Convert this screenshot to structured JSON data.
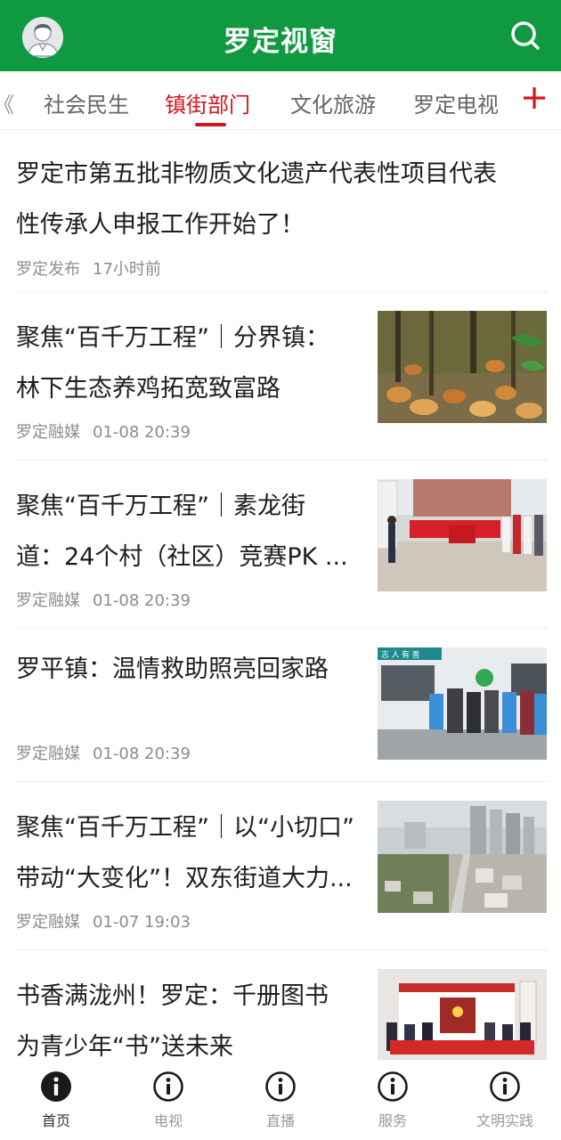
{
  "header": {
    "title": "罗定视窗",
    "brand_color": "#0f9a41"
  },
  "tabs": {
    "partial_left": "《",
    "items": [
      {
        "label": "社会民生",
        "active": false
      },
      {
        "label": "镇街部门",
        "active": true
      },
      {
        "label": "文化旅游",
        "active": false
      },
      {
        "label": "罗定电视",
        "active": false
      }
    ],
    "accent_color": "#d3161e",
    "add_icon": "plus-icon"
  },
  "news": [
    {
      "title_lines": [
        "罗定市第五批非物质文化遗产代表性项目代表",
        "性传承人申报工作开始了！"
      ],
      "source": "罗定发布",
      "time": "17小时前",
      "thumbnail": null
    },
    {
      "title_lines": [
        "聚焦“百千万工程”｜分界镇：",
        "林下生态养鸡拓宽致富路"
      ],
      "source": "罗定融媒",
      "time": "01-08 20:39",
      "thumbnail": "chickens-in-forest"
    },
    {
      "title_lines": [
        "聚焦“百千万工程”｜素龙街",
        "道：24个村（社区）竞赛PK ..."
      ],
      "source": "罗定融媒",
      "time": "01-08 20:39",
      "thumbnail": "village-competition-event"
    },
    {
      "title_lines": [
        "罗平镇：温情救助照亮回家路"
      ],
      "source": "罗定融媒",
      "time": "01-08 20:39",
      "thumbnail": "volunteers-by-van"
    },
    {
      "title_lines": [
        "聚焦“百千万工程”｜以“小切口”",
        "带动“大变化”！双东街道大力..."
      ],
      "source": "罗定融媒",
      "time": "01-07 19:03",
      "thumbnail": "town-aerial-view"
    },
    {
      "title_lines": [
        "书香满泷州！罗定：千册图书",
        "为青少年“书”送未来"
      ],
      "source": "",
      "time": "",
      "thumbnail": "book-donation-group"
    }
  ],
  "thumb_text": {
    "van_sign": "志 人 有 善"
  },
  "bottom_nav": [
    {
      "label": "首页",
      "icon": "info-icon",
      "active": true
    },
    {
      "label": "电视",
      "icon": "info-icon",
      "active": false
    },
    {
      "label": "直播",
      "icon": "info-icon",
      "active": false
    },
    {
      "label": "服务",
      "icon": "info-icon",
      "active": false
    },
    {
      "label": "文明实践",
      "icon": "info-icon",
      "active": false
    }
  ]
}
